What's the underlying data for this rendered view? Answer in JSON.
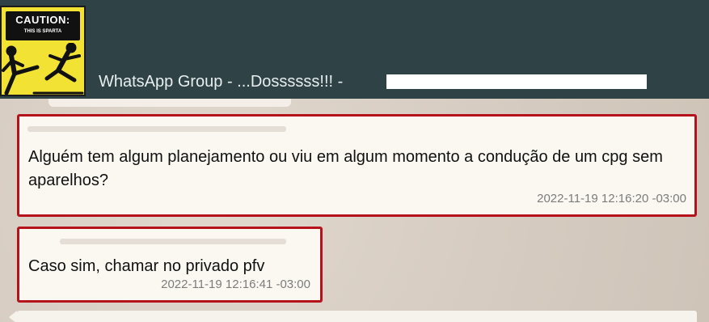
{
  "header": {
    "avatar_top": "CAUTION:",
    "avatar_sub": "THIS IS SPARTA",
    "title": "WhatsApp Group - ...Dossssss!!! -"
  },
  "messages": [
    {
      "text": "Alguém tem algum planejamento ou viu em algum momento a condução de um cpg sem aparelhos?",
      "timestamp": "2022-11-19 12:16:20 -03:00"
    },
    {
      "text": "Caso sim, chamar no privado pfv",
      "timestamp": "2022-11-19 12:16:41 -03:00"
    }
  ],
  "colors": {
    "header_bg": "#2f4245",
    "highlight_border": "#b5121b",
    "bubble_bg": "#fbf8f2"
  }
}
